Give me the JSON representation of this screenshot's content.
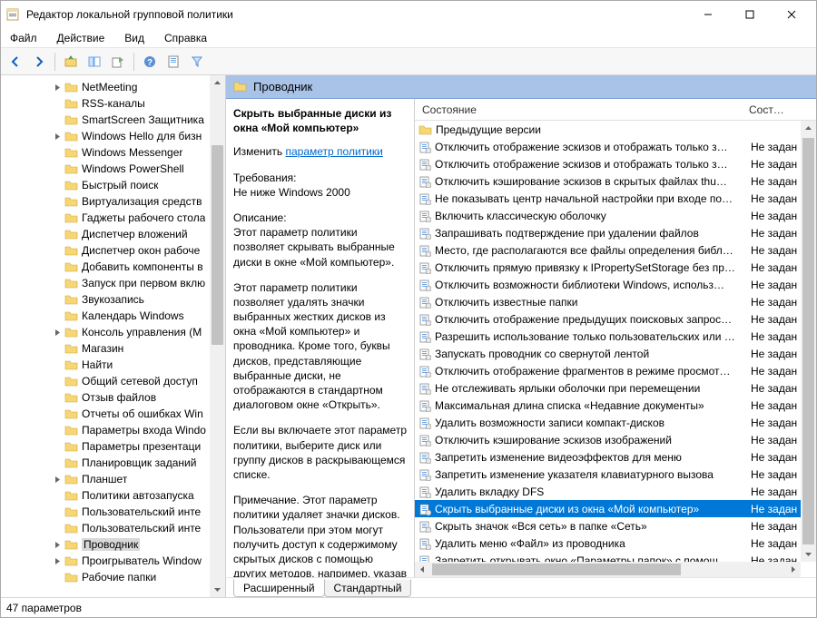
{
  "window": {
    "title": "Редактор локальной групповой политики"
  },
  "menu": {
    "file": "Файл",
    "action": "Действие",
    "view": "Вид",
    "help": "Справка"
  },
  "tree": {
    "items": [
      {
        "label": "NetMeeting",
        "exp": "closed"
      },
      {
        "label": "RSS-каналы",
        "exp": "none"
      },
      {
        "label": "SmartScreen Защитника",
        "exp": "none"
      },
      {
        "label": "Windows Hello для бизн",
        "exp": "closed"
      },
      {
        "label": "Windows Messenger",
        "exp": "none"
      },
      {
        "label": "Windows PowerShell",
        "exp": "none"
      },
      {
        "label": "Быстрый поиск",
        "exp": "none"
      },
      {
        "label": "Виртуализация средств",
        "exp": "none"
      },
      {
        "label": "Гаджеты рабочего стола",
        "exp": "none"
      },
      {
        "label": "Диспетчер вложений",
        "exp": "none"
      },
      {
        "label": "Диспетчер окон рабоче",
        "exp": "none"
      },
      {
        "label": "Добавить компоненты в",
        "exp": "none"
      },
      {
        "label": "Запуск при первом вклю",
        "exp": "none"
      },
      {
        "label": "Звукозапись",
        "exp": "none"
      },
      {
        "label": "Календарь Windows",
        "exp": "none"
      },
      {
        "label": "Консоль управления (M",
        "exp": "closed"
      },
      {
        "label": "Магазин",
        "exp": "none"
      },
      {
        "label": "Найти",
        "exp": "none"
      },
      {
        "label": "Общий сетевой доступ",
        "exp": "none"
      },
      {
        "label": "Отзыв файлов",
        "exp": "none"
      },
      {
        "label": "Отчеты об ошибках Win",
        "exp": "none"
      },
      {
        "label": "Параметры входа Windo",
        "exp": "none"
      },
      {
        "label": "Параметры презентаци",
        "exp": "none"
      },
      {
        "label": "Планировщик заданий",
        "exp": "none"
      },
      {
        "label": "Планшет",
        "exp": "closed"
      },
      {
        "label": "Политики автозапуска",
        "exp": "none"
      },
      {
        "label": "Пользовательский инте",
        "exp": "none"
      },
      {
        "label": "Пользовательский инте",
        "exp": "none"
      },
      {
        "label": "Проводник",
        "exp": "closed",
        "selected": true
      },
      {
        "label": "Проигрыватель Window",
        "exp": "closed"
      },
      {
        "label": "Рабочие папки",
        "exp": "none"
      }
    ]
  },
  "folder_header": "Проводник",
  "detail": {
    "title": "Скрыть выбранные диски из окна «Мой компьютер»",
    "edit_label": "Изменить",
    "edit_link": "параметр политики",
    "req_label": "Требования:",
    "req_value": "Не ниже Windows 2000",
    "desc_label": "Описание:",
    "desc1": "Этот параметр политики позволяет скрывать выбранные диски в окне «Мой компьютер».",
    "desc2": "Этот параметр политики позволяет удалять значки выбранных жестких дисков из окна «Мой компьютер» и проводника. Кроме того, буквы дисков, представляющие выбранные диски, не отображаются в стандартном диалоговом окне «Открыть».",
    "desc3": "Если вы включаете этот параметр политики, выберите диск или группу дисков в раскрывающемся списке.",
    "desc4": "Примечание. Этот параметр политики удаляет значки дисков. Пользователи при этом могут получить доступ к содержимому скрытых дисков с помощью других методов, например, указав путь к"
  },
  "list": {
    "col_name": "Состояние",
    "col_state": "Состоян",
    "folder_item": "Предыдущие версии",
    "rows": [
      {
        "name": "Отключить отображение эскизов и отображать только з…",
        "state": "Не задан"
      },
      {
        "name": "Отключить отображение эскизов и отображать только з…",
        "state": "Не задан"
      },
      {
        "name": "Отключить кэширование эскизов в скрытых файлах thu…",
        "state": "Не задан"
      },
      {
        "name": "Не показывать центр начальной настройки при входе по…",
        "state": "Не задан"
      },
      {
        "name": "Включить классическую оболочку",
        "state": "Не задан"
      },
      {
        "name": "Запрашивать подтверждение при удалении файлов",
        "state": "Не задан"
      },
      {
        "name": "Место, где располагаются все файлы определения библ…",
        "state": "Не задан"
      },
      {
        "name": "Отключить прямую привязку к IPropertySetStorage без пр…",
        "state": "Не задан"
      },
      {
        "name": "Отключить возможности библиотеки Windows, использ…",
        "state": "Не задан"
      },
      {
        "name": "Отключить известные папки",
        "state": "Не задан"
      },
      {
        "name": "Отключить отображение предыдущих поисковых запрос…",
        "state": "Не задан"
      },
      {
        "name": "Разрешить использование только пользовательских или …",
        "state": "Не задан"
      },
      {
        "name": "Запускать проводник со свернутой лентой",
        "state": "Не задан"
      },
      {
        "name": "Отключить отображение фрагментов в режиме просмот…",
        "state": "Не задан"
      },
      {
        "name": "Не отслеживать ярлыки оболочки при перемещении",
        "state": "Не задан"
      },
      {
        "name": "Максимальная длина списка «Недавние документы»",
        "state": "Не задан"
      },
      {
        "name": "Удалить возможности записи компакт-дисков",
        "state": "Не задан"
      },
      {
        "name": "Отключить кэширование эскизов изображений",
        "state": "Не задан"
      },
      {
        "name": "Запретить изменение видеоэффектов для меню",
        "state": "Не задан"
      },
      {
        "name": "Запретить изменение указателя клавиатурного вызова",
        "state": "Не задан"
      },
      {
        "name": "Удалить вкладку DFS",
        "state": "Не задан"
      },
      {
        "name": "Скрыть выбранные диски из окна «Мой компьютер»",
        "state": "Не задан",
        "selected": true
      },
      {
        "name": "Скрыть значок «Вся сеть» в папке «Сеть»",
        "state": "Не задан"
      },
      {
        "name": "Удалить меню «Файл» из проводника",
        "state": "Не задан"
      },
      {
        "name": "Запретить открывать окно «Параметры папок» с помощ…",
        "state": "Не задан"
      }
    ]
  },
  "tabs": {
    "extended": "Расширенный",
    "standard": "Стандартный"
  },
  "status": "47 параметров"
}
